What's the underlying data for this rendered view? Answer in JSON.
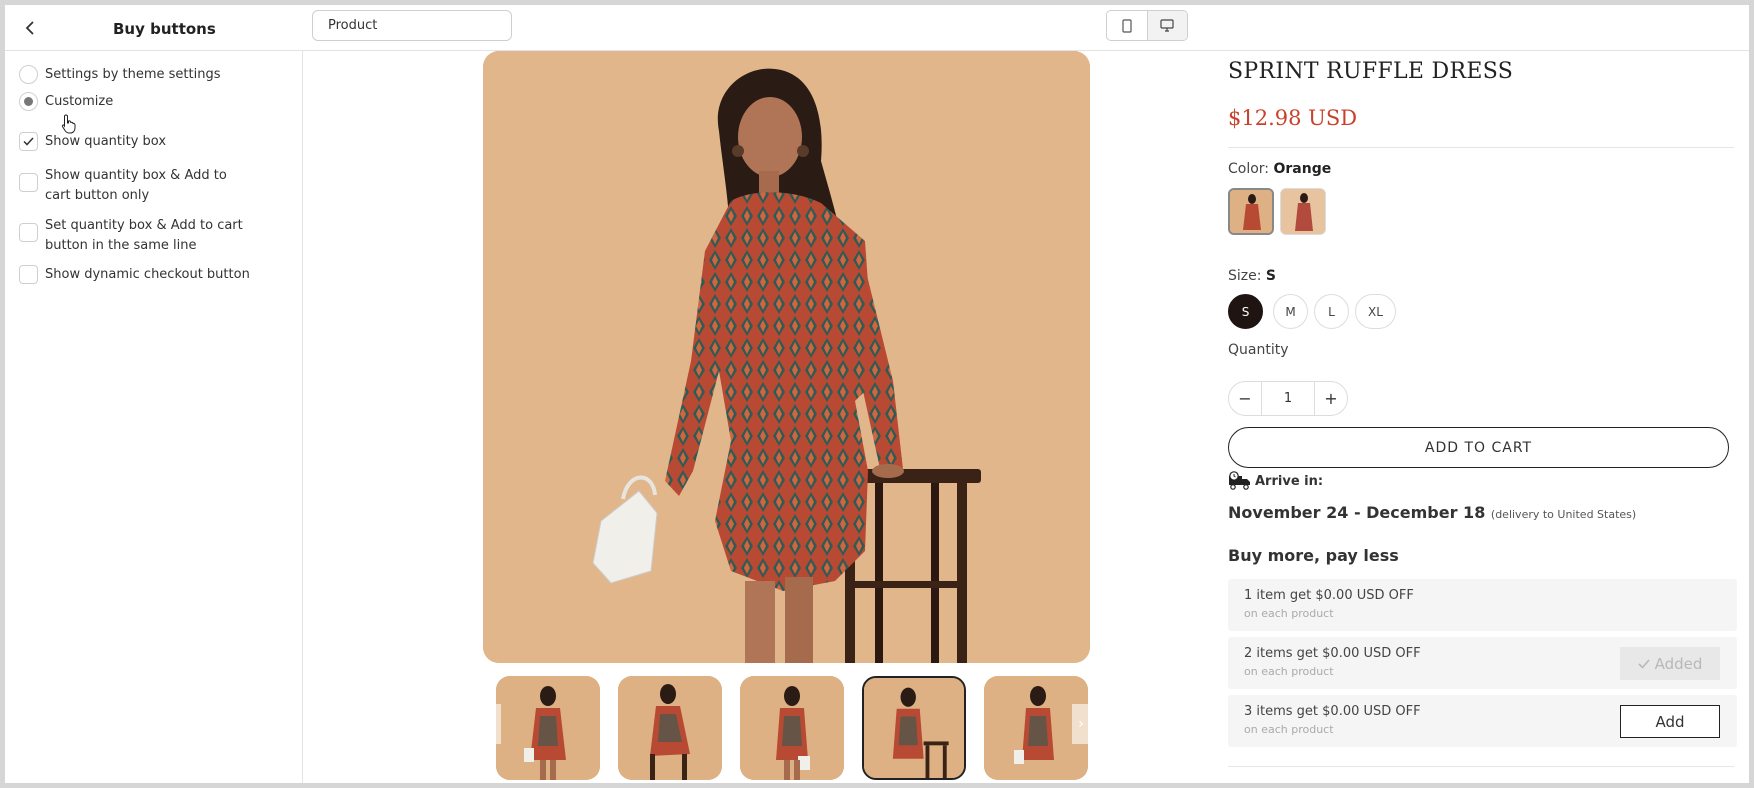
{
  "header": {
    "title": "Buy buttons",
    "product_select_value": "Product",
    "device_options": [
      "mobile-icon",
      "desktop-icon"
    ],
    "selected_device": "desktop"
  },
  "sidebar": {
    "mode_options": [
      {
        "label": "Settings by theme settings",
        "selected": false
      },
      {
        "label": "Customize",
        "selected": true
      }
    ],
    "checkboxes": [
      {
        "label": "Show quantity box",
        "checked": true
      },
      {
        "label": "Show quantity box & Add to cart button only",
        "checked": false
      },
      {
        "label": "Set quantity box & Add to cart button in the same line",
        "checked": false
      },
      {
        "label": "Show dynamic checkout button",
        "checked": false
      }
    ]
  },
  "gallery": {
    "thumbnail_count": 5,
    "active_thumbnail": 4
  },
  "product": {
    "title": "SPRINT RUFFLE DRESS",
    "price": "$12.98 USD",
    "color_label": "Color:",
    "color_value": "Orange",
    "size_label": "Size:",
    "size_value": "S",
    "sizes": [
      "S",
      "M",
      "L",
      "XL"
    ],
    "quantity_label": "Quantity",
    "quantity_value": "1",
    "qty_minus": "−",
    "qty_plus": "+",
    "add_to_cart": "ADD TO CART",
    "arrive_label": "Arrive in:",
    "delivery_dates": "November 24 - December 18",
    "delivery_note": "(delivery to United States)"
  },
  "bundle": {
    "title": "Buy more, pay less",
    "tiers": [
      {
        "main": "1 item get $0.00 USD OFF",
        "sub": "on each product",
        "button": ""
      },
      {
        "main": "2 items get $0.00 USD OFF",
        "sub": "on each product",
        "button": "Added"
      },
      {
        "main": "3 items get $0.00 USD OFF",
        "sub": "on each product",
        "button": "Add"
      }
    ]
  },
  "colors": {
    "price": "#c8422b",
    "dress_base": "#b84a34",
    "dress_pattern": "#2f5b55",
    "background_beige": "#e5bd92"
  }
}
